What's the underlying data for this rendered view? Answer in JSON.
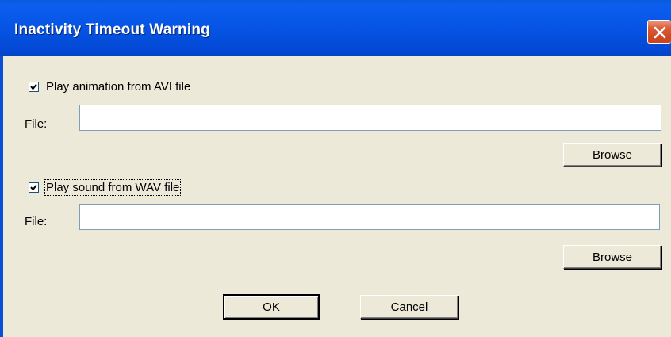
{
  "window": {
    "title": "Inactivity Timeout Warning",
    "close_icon": "close-x-icon"
  },
  "animation": {
    "checkbox_label": "Play animation from AVI file",
    "checked": true,
    "file_label": "File:",
    "file_value": "",
    "browse_label": "Browse"
  },
  "sound": {
    "checkbox_label": "Play sound from WAV file",
    "checked": true,
    "file_label": "File:",
    "file_value": "",
    "browse_label": "Browse"
  },
  "buttons": {
    "ok_label": "OK",
    "cancel_label": "Cancel"
  },
  "colors": {
    "titlebar": "#0654e4",
    "close_button": "#d04a24",
    "dialog_background": "#ece9d8"
  }
}
